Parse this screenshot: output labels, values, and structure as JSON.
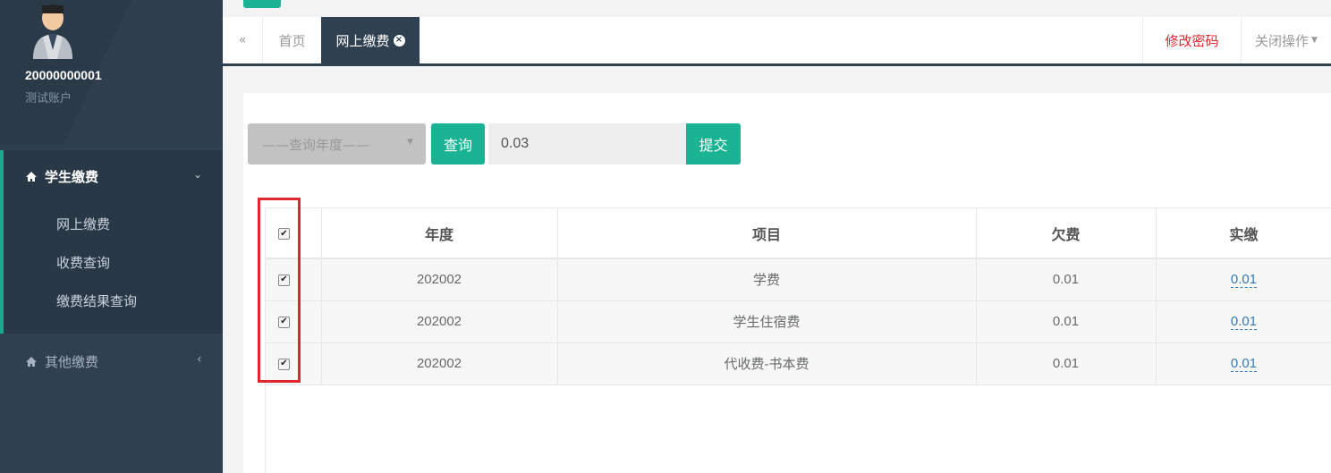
{
  "user": {
    "id": "20000000001",
    "name": "测试账户"
  },
  "sidebar": {
    "active_menu": {
      "label": "学生缴费",
      "chevron": "⌄"
    },
    "sub_items": [
      {
        "label": "网上缴费"
      },
      {
        "label": "收费查询"
      },
      {
        "label": "缴费结果查询"
      }
    ],
    "other_menu": {
      "label": "其他缴费",
      "chevron": "‹"
    }
  },
  "tabs": {
    "back_icon": "«",
    "home": "首页",
    "active": "网上缴费",
    "close_icon": "×",
    "change_password": "修改密码",
    "close_ops": "关闭操作"
  },
  "toolbar": {
    "year_placeholder": "——查询年度——",
    "query_label": "查询",
    "amount_value": "0.03",
    "submit_label": "提交"
  },
  "table": {
    "checkbox_mark": "✔",
    "headers": [
      "年度",
      "项目",
      "欠费",
      "实缴"
    ],
    "rows": [
      {
        "year": "202002",
        "item": "学费",
        "owed": "0.01",
        "paid": "0.01"
      },
      {
        "year": "202002",
        "item": "学生住宿费",
        "owed": "0.01",
        "paid": "0.01"
      },
      {
        "year": "202002",
        "item": "代收费-书本费",
        "owed": "0.01",
        "paid": "0.01"
      }
    ]
  },
  "colors": {
    "sidebar": "#2f4050",
    "accent": "#1ab394",
    "danger": "#e3262d",
    "link": "#337ab7"
  }
}
